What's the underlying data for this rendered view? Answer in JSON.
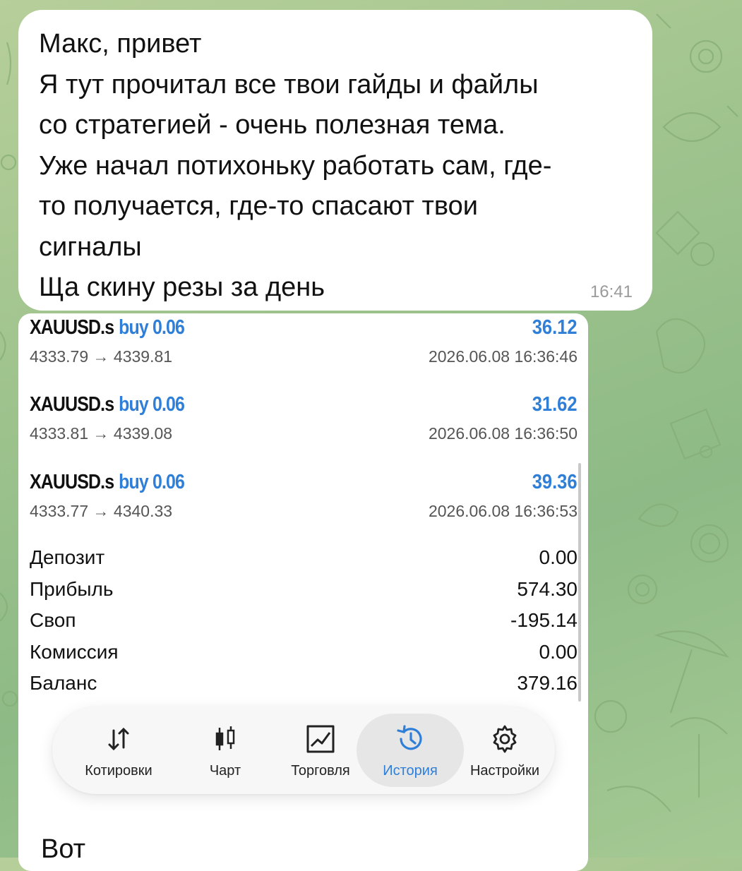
{
  "message": {
    "lines": [
      "Макс, привет",
      "Я тут прочитал все твои гайды и файлы",
      "со стратегией - очень полезная тема.",
      "Уже начал потихоньку работать сам, где-",
      "то получается, где-то спасают твои",
      "сигналы",
      "Ща скину резы за день"
    ],
    "time": "16:41"
  },
  "screenshot": {
    "deals": [
      {
        "symbol": "XAUUSD.s",
        "side": "buy 0.06",
        "profit": "36.12",
        "prices": "4333.79 → 4339.81",
        "datetime": "2026.06.08 16:36:46"
      },
      {
        "symbol": "XAUUSD.s",
        "side": "buy 0.06",
        "profit": "31.62",
        "prices": "4333.81 → 4339.08",
        "datetime": "2026.06.08 16:36:50"
      },
      {
        "symbol": "XAUUSD.s",
        "side": "buy 0.06",
        "profit": "39.36",
        "prices": "4333.77 → 4340.33",
        "datetime": "2026.06.08 16:36:53"
      }
    ],
    "summary": [
      {
        "label": "Депозит",
        "value": "0.00"
      },
      {
        "label": "Прибыль",
        "value": "574.30"
      },
      {
        "label": "Своп",
        "value": "-195.14"
      },
      {
        "label": "Комиссия",
        "value": "0.00"
      },
      {
        "label": "Баланс",
        "value": "379.16"
      }
    ],
    "tabs": [
      {
        "label": "Котировки",
        "icon": "quotes-arrows-icon",
        "active": false
      },
      {
        "label": "Чарт",
        "icon": "candlestick-icon",
        "active": false
      },
      {
        "label": "Торговля",
        "icon": "trade-chart-icon",
        "active": false
      },
      {
        "label": "История",
        "icon": "history-clock-icon",
        "active": true
      },
      {
        "label": "Настройки",
        "icon": "gear-icon",
        "active": false
      }
    ],
    "next_message_text": "Вот"
  },
  "colors": {
    "accent": "#2f7fd8",
    "bubble": "#ffffff",
    "chat_background": "#9fc38d"
  }
}
